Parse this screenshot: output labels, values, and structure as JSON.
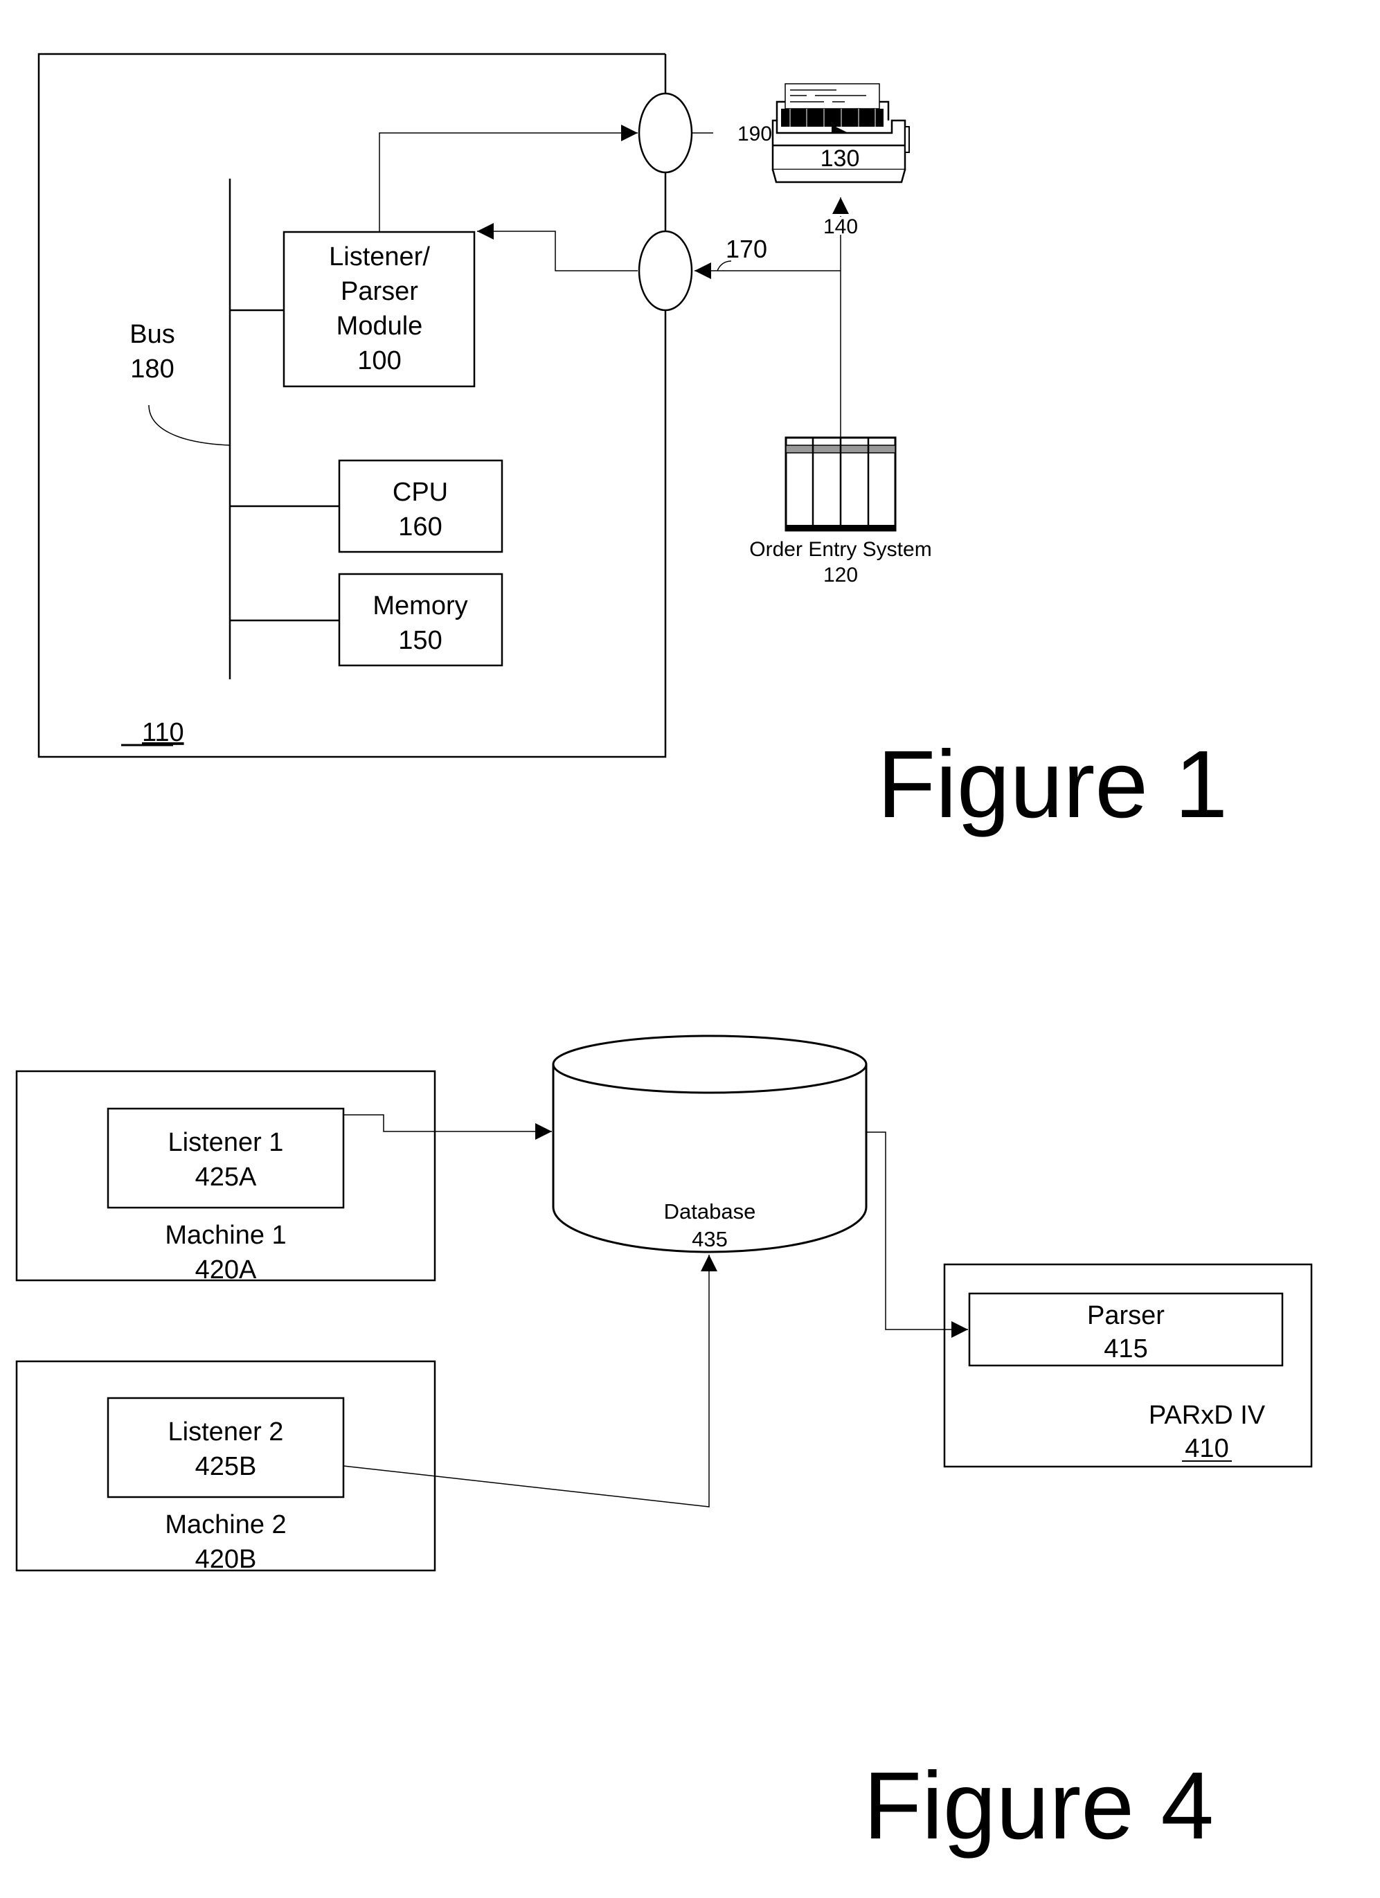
{
  "figure1": {
    "title": "Figure 1",
    "system": {
      "ref": "110"
    },
    "bus": {
      "label": "Bus",
      "ref": "180"
    },
    "listener_parser": {
      "line1": "Listener/",
      "line2": "Parser",
      "line3": "Module",
      "ref": "100"
    },
    "cpu": {
      "label": "CPU",
      "ref": "160"
    },
    "memory": {
      "label": "Memory",
      "ref": "150"
    },
    "printer": {
      "ref": "130"
    },
    "order_entry": {
      "label": "Order Entry System",
      "ref": "120"
    },
    "connections": {
      "out_ref": "190",
      "in_ref": "170",
      "direct_ref": "140"
    }
  },
  "figure4": {
    "title": "Figure 4",
    "machine1": {
      "label": "Machine 1",
      "ref": "420A"
    },
    "listener1": {
      "label": "Listener 1",
      "ref": "425A"
    },
    "machine2": {
      "label": "Machine 2",
      "ref": "420B"
    },
    "listener2": {
      "label": "Listener 2",
      "ref": "425B"
    },
    "database": {
      "label": "Database",
      "ref": "435"
    },
    "parxd": {
      "label": "PARxD IV",
      "ref": "410"
    },
    "parser": {
      "label": "Parser",
      "ref": "415"
    }
  }
}
